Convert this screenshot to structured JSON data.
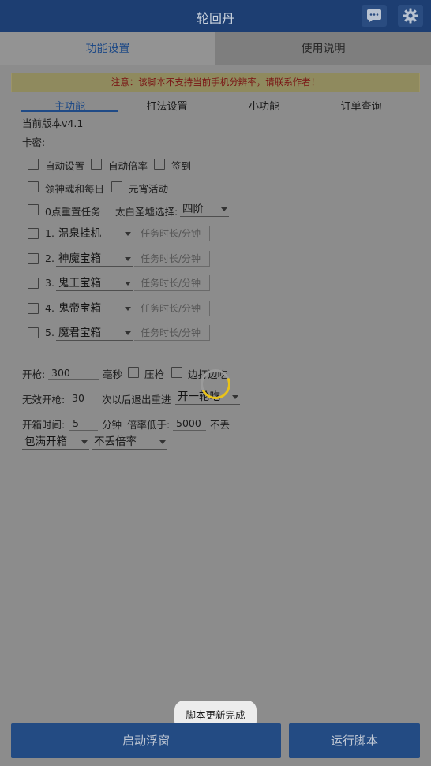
{
  "app": {
    "title": "轮回丹"
  },
  "main_tabs": [
    {
      "label": "功能设置",
      "active": true
    },
    {
      "label": "使用说明",
      "active": false
    }
  ],
  "warning": "注意：该脚本不支持当前手机分辨率，请联系作者！",
  "sub_tabs": [
    {
      "label": "主功能",
      "active": true
    },
    {
      "label": "打法设置",
      "active": false
    },
    {
      "label": "小功能",
      "active": false
    },
    {
      "label": "订单查询",
      "active": false
    }
  ],
  "version_text": "当前版本v4.1",
  "card_key": {
    "label": "卡密:",
    "value": ""
  },
  "row1": [
    {
      "label": "自动设置",
      "checked": false
    },
    {
      "label": "自动倍率",
      "checked": false
    },
    {
      "label": "签到",
      "checked": false
    }
  ],
  "row2": [
    {
      "label": "领神魂和每日",
      "checked": false
    },
    {
      "label": "元宵活动",
      "checked": false
    }
  ],
  "reset": {
    "label": "0点重置任务",
    "checked": false
  },
  "taibai": {
    "label": "太白圣墟选择:",
    "value": "四阶"
  },
  "tasks": [
    {
      "num": "1.",
      "name": "温泉挂机",
      "placeholder": "任务时长/分钟",
      "checked": false
    },
    {
      "num": "2.",
      "name": "神魔宝箱",
      "placeholder": "任务时长/分钟",
      "checked": false
    },
    {
      "num": "3.",
      "name": "鬼王宝箱",
      "placeholder": "任务时长/分钟",
      "checked": false
    },
    {
      "num": "4.",
      "name": "鬼帝宝箱",
      "placeholder": "任务时长/分钟",
      "checked": false
    },
    {
      "num": "5.",
      "name": "魔君宝箱",
      "placeholder": "任务时长/分钟",
      "checked": false
    }
  ],
  "divider": "- - - - - - - - - - - - - - - - - - - - - - - - - - -",
  "fire": {
    "label": "开枪:",
    "value": "300",
    "unit": "毫秒",
    "press_label": "压枪",
    "edge_label": "边打边吃"
  },
  "invalid": {
    "label": "无效开枪:",
    "value": "30",
    "suffix": "次以后退出重进",
    "select": "开一轮吃"
  },
  "box_time": {
    "label": "开箱时间:",
    "value": "5",
    "unit": "分钟",
    "rate_label": "倍率低于:",
    "rate_value": "5000",
    "suffix": "不丢"
  },
  "selects_bottom": [
    "包满开箱",
    "不丢倍率"
  ],
  "toast": "脚本更新完成",
  "buttons": {
    "float": "启动浮窗",
    "run": "运行脚本"
  },
  "icons": {
    "chat": "chat-bubble-icon",
    "settings": "gear-icon"
  },
  "colors": {
    "header": "#1d3e72",
    "button": "#234b83",
    "accent": "#1f4a86",
    "warning_text": "#7a1414",
    "spinner": "#e8c21a"
  }
}
